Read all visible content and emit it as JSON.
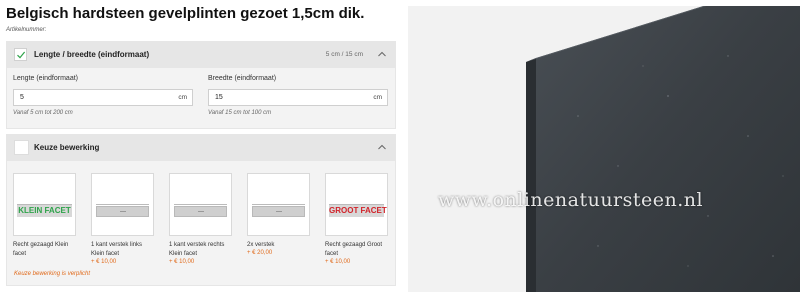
{
  "page": {
    "title": "Belgisch hardsteen gevelplinten gezoet 1,5cm dik.",
    "article_number_label": "Artikelnummer:"
  },
  "dimensions_section": {
    "title": "Lengte / breedte (eindformaat)",
    "summary": "5 cm / 15 cm",
    "length": {
      "label": "Lengte (eindformaat)",
      "value": "5",
      "unit": "cm",
      "hint": "Vanaf 5 cm tot 200 cm"
    },
    "width": {
      "label": "Breedte (eindformaat)",
      "value": "15",
      "unit": "cm",
      "hint": "Vanaf 15 cm tot 100 cm"
    }
  },
  "processing_section": {
    "title": "Keuze bewerking",
    "options": [
      {
        "image_text": "KLEIN FACET",
        "caption": "Recht gezaagd Klein facet",
        "price": ""
      },
      {
        "image_text": "",
        "caption": "1 kant verstek links Klein facet",
        "price": "+ € 10,00"
      },
      {
        "image_text": "",
        "caption": "1 kant verstek rechts Klein facet",
        "price": "+ € 10,00"
      },
      {
        "image_text": "",
        "caption": "2x verstek",
        "price": "+ € 20,00"
      },
      {
        "image_text": "GROOT FACET",
        "caption": "Recht gezaagd Groot facet",
        "price": "+ € 10,00"
      }
    ],
    "error": "Keuze bewerking is verplicht"
  },
  "product_image": {
    "watermark": "www.onlinenatuursteen.nl",
    "colors": {
      "stone": "#3a3f44",
      "edge": "#2c3034",
      "background": "#f2f2f2"
    }
  },
  "colors": {
    "accent": "#e06a1b",
    "check": "#2ea34a",
    "facet_red": "#d2232a"
  }
}
